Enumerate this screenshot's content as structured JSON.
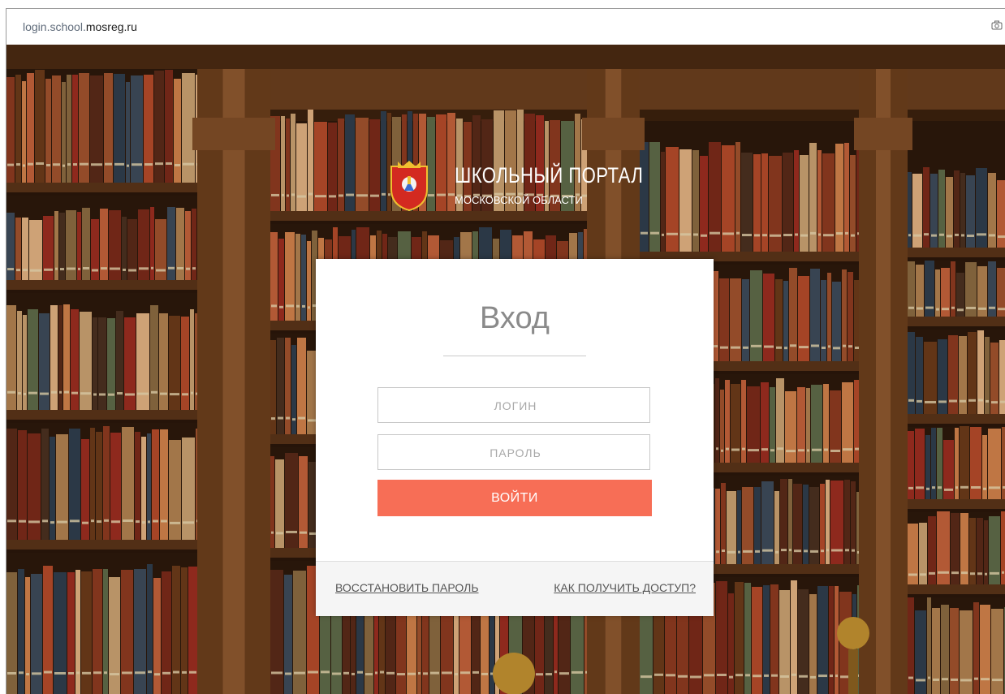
{
  "browser": {
    "url_prefix": "login.school.",
    "url_domain": "mosreg.ru",
    "camera_icon": "camera-icon"
  },
  "brand": {
    "title": "ШКОЛЬНЫЙ ПОРТАЛ",
    "subtitle": "МОСКОВСКОЙ ОБЛАСТИ",
    "emblem_icon": "moscow-oblast-emblem-icon"
  },
  "login": {
    "heading": "Вход",
    "login_placeholder": "ЛОГИН",
    "password_placeholder": "ПАРОЛЬ",
    "submit_label": "ВОЙТИ",
    "restore_link": "ВОССТАНОВИТЬ ПАРОЛЬ",
    "access_link": "КАК ПОЛУЧИТЬ ДОСТУП?"
  },
  "colors": {
    "accent": "#f76e56",
    "heading": "#8a8a8a"
  }
}
